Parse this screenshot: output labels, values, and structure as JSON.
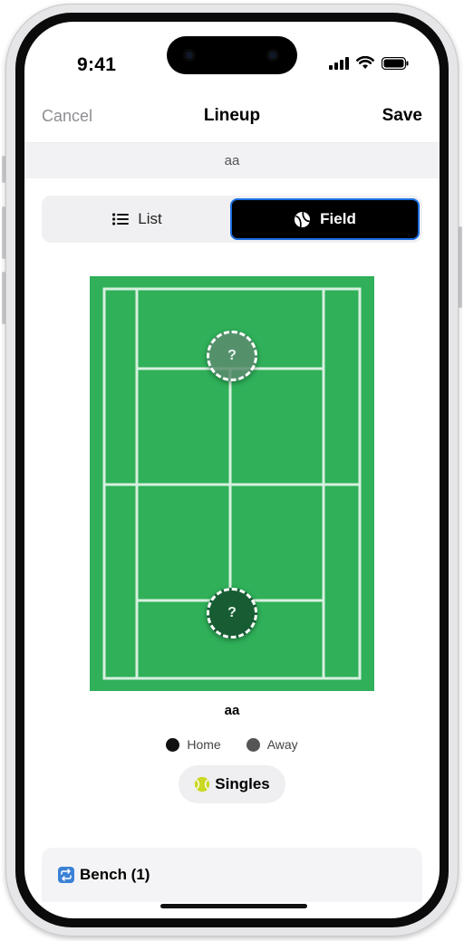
{
  "status_bar": {
    "time": "9:41"
  },
  "nav": {
    "cancel": "Cancel",
    "title": "Lineup",
    "save": "Save"
  },
  "subtitle": "aa",
  "view_toggle": {
    "list_label": "List",
    "field_label": "Field",
    "selected": "Field",
    "selected_color": "#000000",
    "focus_color": "#1b6fe0"
  },
  "court": {
    "surface_color": "#2fb059",
    "players": [
      {
        "team": "Away",
        "label": "?"
      },
      {
        "team": "Home",
        "label": "?"
      }
    ],
    "caption": "aa"
  },
  "legend": [
    {
      "label": "Home",
      "color": "#111111"
    },
    {
      "label": "Away",
      "color": "#555555"
    }
  ],
  "format_pill": {
    "icon": "tennis-ball-icon",
    "label": "Singles"
  },
  "bench": {
    "icon": "repeat-icon",
    "label": "Bench (1)"
  }
}
